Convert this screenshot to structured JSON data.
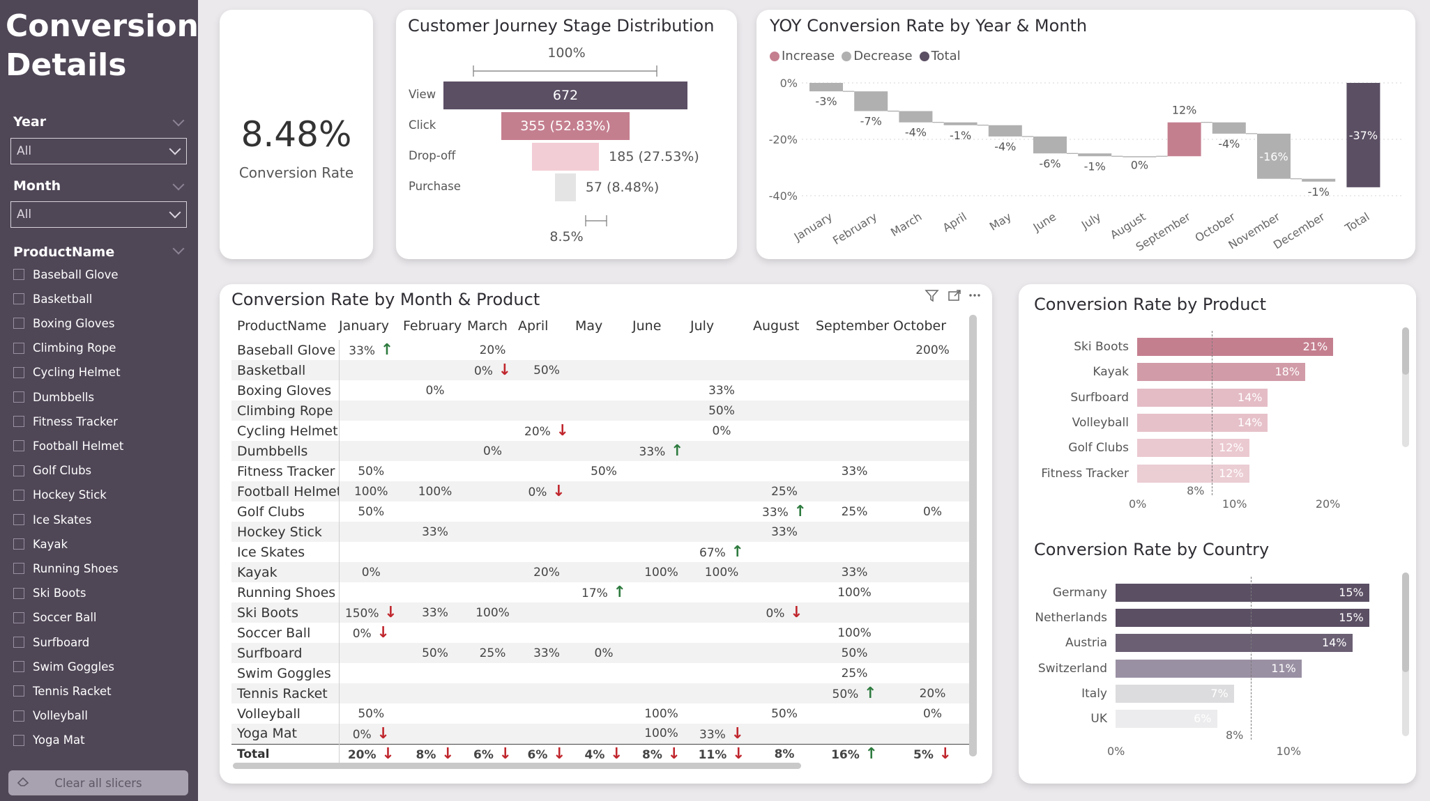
{
  "sidebar": {
    "title_line1": "Conversion",
    "title_line2": "Details",
    "year_label": "Year",
    "year_value": "All",
    "month_label": "Month",
    "month_value": "All",
    "product_label": "ProductName",
    "products": [
      "Baseball Glove",
      "Basketball",
      "Boxing Gloves",
      "Climbing Rope",
      "Cycling Helmet",
      "Dumbbells",
      "Fitness Tracker",
      "Football Helmet",
      "Golf Clubs",
      "Hockey Stick",
      "Ice Skates",
      "Kayak",
      "Running Shoes",
      "Ski Boots",
      "Soccer Ball",
      "Surfboard",
      "Swim Goggles",
      "Tennis Racket",
      "Volleyball",
      "Yoga Mat"
    ],
    "clear_label": "Clear all slicers"
  },
  "kpi": {
    "value": "8.48%",
    "label": "Conversion Rate"
  },
  "funnel": {
    "title": "Customer Journey Stage Distribution",
    "top_label": "100%",
    "bottom_label": "8.5%",
    "stages": [
      {
        "label": "View",
        "value": 672,
        "text": "672",
        "color": "#5b4f64"
      },
      {
        "label": "Click",
        "value": 355,
        "text": "355 (52.83%)",
        "color": "#c47f8f"
      },
      {
        "label": "Drop-off",
        "value": 185,
        "text": "185 (27.53%)",
        "color": "#f3cdd5"
      },
      {
        "label": "Purchase",
        "value": 57,
        "text": "57 (8.48%)",
        "color": "#e4e4e4"
      }
    ]
  },
  "waterfall": {
    "title": "YOY Conversion Rate by Year & Month",
    "legend": [
      {
        "label": "Increase",
        "color": "#c47f8f"
      },
      {
        "label": "Decrease",
        "color": "#b0b0b0"
      },
      {
        "label": "Total",
        "color": "#5b4f64"
      }
    ],
    "y_ticks": [
      "0%",
      "-20%",
      "-40%"
    ]
  },
  "chart_data": [
    {
      "type": "bar",
      "title": "YOY Conversion Rate by Year & Month",
      "subtype": "waterfall",
      "categories": [
        "January",
        "February",
        "March",
        "April",
        "May",
        "June",
        "July",
        "August",
        "September",
        "October",
        "November",
        "December",
        "Total"
      ],
      "values": [
        -3,
        -7,
        -4,
        -1,
        -4,
        -6,
        -1,
        0,
        12,
        -4,
        -16,
        -1,
        -37
      ],
      "labels": [
        "-3%",
        "-7%",
        "-4%",
        "-1%",
        "-4%",
        "-6%",
        "-1%",
        "0%",
        "12%",
        "-4%",
        "-16%",
        "-1%",
        "-37%"
      ],
      "ylim": [
        -40,
        0
      ]
    },
    {
      "type": "bar",
      "title": "Conversion Rate by Product",
      "categories": [
        "Ski Boots",
        "Kayak",
        "Surfboard",
        "Volleyball",
        "Golf Clubs",
        "Fitness Tracker"
      ],
      "values": [
        21,
        18,
        14,
        14,
        12,
        12
      ],
      "labels": [
        "21%",
        "18%",
        "14%",
        "14%",
        "12%",
        "12%"
      ],
      "reference_line": 8,
      "reference_label": "8%",
      "x_ticks": [
        "0%",
        "10%",
        "20%"
      ],
      "xlim": [
        0,
        23
      ],
      "colors": [
        "#c47f8f",
        "#d19ba8",
        "#e4bcc6",
        "#e6c1ca",
        "#ebc9d1",
        "#ebcdd4"
      ]
    },
    {
      "type": "bar",
      "title": "Conversion Rate by Country",
      "categories": [
        "Germany",
        "Netherlands",
        "Austria",
        "Switzerland",
        "Italy",
        "UK"
      ],
      "values": [
        15,
        15,
        14,
        11,
        7,
        6
      ],
      "labels": [
        "15%",
        "15%",
        "14%",
        "11%",
        "7%",
        "6%"
      ],
      "reference_line": 8,
      "reference_label": "8%",
      "x_ticks": [
        "0%",
        "10%"
      ],
      "xlim": [
        0,
        16
      ],
      "colors": [
        "#5b4f64",
        "#5b4f64",
        "#6a5f73",
        "#9a90a3",
        "#dcdcde",
        "#ececee"
      ]
    }
  ],
  "matrix": {
    "title": "Conversion Rate by Month & Product",
    "columns": [
      "ProductName",
      "January",
      "February",
      "March",
      "April",
      "May",
      "June",
      "July",
      "August",
      "September",
      "October"
    ],
    "rows": [
      {
        "name": "Baseball Glove",
        "cells": [
          [
            "33%",
            "up"
          ],
          [
            "",
            ""
          ],
          [
            "20%",
            ""
          ],
          [
            "",
            ""
          ],
          [
            "",
            ""
          ],
          [
            "",
            ""
          ],
          [
            "",
            ""
          ],
          [
            "",
            ""
          ],
          [
            "",
            ""
          ],
          [
            "200%",
            ""
          ]
        ]
      },
      {
        "name": "Basketball",
        "cells": [
          [
            "",
            ""
          ],
          [
            "",
            ""
          ],
          [
            "0%",
            "down"
          ],
          [
            "50%",
            ""
          ],
          [
            "",
            ""
          ],
          [
            "",
            ""
          ],
          [
            "",
            ""
          ],
          [
            "",
            ""
          ],
          [
            "",
            ""
          ],
          [
            "",
            ""
          ]
        ]
      },
      {
        "name": "Boxing Gloves",
        "cells": [
          [
            "",
            ""
          ],
          [
            "0%",
            ""
          ],
          [
            "",
            ""
          ],
          [
            "",
            ""
          ],
          [
            "",
            ""
          ],
          [
            "",
            ""
          ],
          [
            "33%",
            ""
          ],
          [
            "",
            ""
          ],
          [
            "",
            ""
          ],
          [
            "",
            ""
          ]
        ]
      },
      {
        "name": "Climbing Rope",
        "cells": [
          [
            "",
            ""
          ],
          [
            "",
            ""
          ],
          [
            "",
            ""
          ],
          [
            "",
            ""
          ],
          [
            "",
            ""
          ],
          [
            "",
            ""
          ],
          [
            "50%",
            ""
          ],
          [
            "",
            ""
          ],
          [
            "",
            ""
          ],
          [
            "",
            ""
          ]
        ]
      },
      {
        "name": "Cycling Helmet",
        "cells": [
          [
            "",
            ""
          ],
          [
            "",
            ""
          ],
          [
            "",
            ""
          ],
          [
            "20%",
            "down"
          ],
          [
            "",
            ""
          ],
          [
            "",
            ""
          ],
          [
            "0%",
            ""
          ],
          [
            "",
            ""
          ],
          [
            "",
            ""
          ],
          [
            "",
            ""
          ]
        ]
      },
      {
        "name": "Dumbbells",
        "cells": [
          [
            "",
            ""
          ],
          [
            "",
            ""
          ],
          [
            "0%",
            ""
          ],
          [
            "",
            ""
          ],
          [
            "",
            ""
          ],
          [
            "33%",
            "up"
          ],
          [
            "",
            ""
          ],
          [
            "",
            ""
          ],
          [
            "",
            ""
          ],
          [
            "",
            ""
          ]
        ]
      },
      {
        "name": "Fitness Tracker",
        "cells": [
          [
            "50%",
            ""
          ],
          [
            "",
            ""
          ],
          [
            "",
            ""
          ],
          [
            "",
            ""
          ],
          [
            "50%",
            ""
          ],
          [
            "",
            ""
          ],
          [
            "",
            ""
          ],
          [
            "",
            ""
          ],
          [
            "33%",
            ""
          ],
          [
            "",
            ""
          ]
        ]
      },
      {
        "name": "Football Helmet",
        "cells": [
          [
            "100%",
            ""
          ],
          [
            "100%",
            ""
          ],
          [
            "",
            ""
          ],
          [
            "0%",
            "down"
          ],
          [
            "",
            ""
          ],
          [
            "",
            ""
          ],
          [
            "",
            ""
          ],
          [
            "25%",
            ""
          ],
          [
            "",
            ""
          ],
          [
            "",
            ""
          ]
        ]
      },
      {
        "name": "Golf Clubs",
        "cells": [
          [
            "50%",
            ""
          ],
          [
            "",
            ""
          ],
          [
            "",
            ""
          ],
          [
            "",
            ""
          ],
          [
            "",
            ""
          ],
          [
            "",
            ""
          ],
          [
            "",
            ""
          ],
          [
            "33%",
            "up"
          ],
          [
            "25%",
            ""
          ],
          [
            "0%",
            ""
          ]
        ]
      },
      {
        "name": "Hockey Stick",
        "cells": [
          [
            "",
            ""
          ],
          [
            "33%",
            ""
          ],
          [
            "",
            ""
          ],
          [
            "",
            ""
          ],
          [
            "",
            ""
          ],
          [
            "",
            ""
          ],
          [
            "",
            ""
          ],
          [
            "33%",
            ""
          ],
          [
            "",
            ""
          ],
          [
            "",
            ""
          ]
        ]
      },
      {
        "name": "Ice Skates",
        "cells": [
          [
            "",
            ""
          ],
          [
            "",
            ""
          ],
          [
            "",
            ""
          ],
          [
            "",
            ""
          ],
          [
            "",
            ""
          ],
          [
            "",
            ""
          ],
          [
            "67%",
            "up"
          ],
          [
            "",
            ""
          ],
          [
            "",
            ""
          ],
          [
            "",
            ""
          ]
        ]
      },
      {
        "name": "Kayak",
        "cells": [
          [
            "0%",
            ""
          ],
          [
            "",
            ""
          ],
          [
            "",
            ""
          ],
          [
            "20%",
            ""
          ],
          [
            "",
            ""
          ],
          [
            "100%",
            ""
          ],
          [
            "100%",
            ""
          ],
          [
            "",
            ""
          ],
          [
            "33%",
            ""
          ],
          [
            "",
            ""
          ]
        ]
      },
      {
        "name": "Running Shoes",
        "cells": [
          [
            "",
            ""
          ],
          [
            "",
            ""
          ],
          [
            "",
            ""
          ],
          [
            "",
            ""
          ],
          [
            "17%",
            "up"
          ],
          [
            "",
            ""
          ],
          [
            "",
            ""
          ],
          [
            "",
            ""
          ],
          [
            "100%",
            ""
          ],
          [
            "",
            ""
          ]
        ]
      },
      {
        "name": "Ski Boots",
        "cells": [
          [
            "150%",
            "down"
          ],
          [
            "33%",
            ""
          ],
          [
            "100%",
            ""
          ],
          [
            "",
            ""
          ],
          [
            "",
            ""
          ],
          [
            "",
            ""
          ],
          [
            "",
            ""
          ],
          [
            "0%",
            "down"
          ],
          [
            "",
            ""
          ],
          [
            "",
            ""
          ]
        ]
      },
      {
        "name": "Soccer Ball",
        "cells": [
          [
            "0%",
            "down"
          ],
          [
            "",
            ""
          ],
          [
            "",
            ""
          ],
          [
            "",
            ""
          ],
          [
            "",
            ""
          ],
          [
            "",
            ""
          ],
          [
            "",
            ""
          ],
          [
            "",
            ""
          ],
          [
            "100%",
            ""
          ],
          [
            "",
            ""
          ]
        ]
      },
      {
        "name": "Surfboard",
        "cells": [
          [
            "",
            ""
          ],
          [
            "50%",
            ""
          ],
          [
            "25%",
            ""
          ],
          [
            "33%",
            ""
          ],
          [
            "0%",
            ""
          ],
          [
            "",
            ""
          ],
          [
            "",
            ""
          ],
          [
            "",
            ""
          ],
          [
            "50%",
            ""
          ],
          [
            "",
            ""
          ]
        ]
      },
      {
        "name": "Swim Goggles",
        "cells": [
          [
            "",
            ""
          ],
          [
            "",
            ""
          ],
          [
            "",
            ""
          ],
          [
            "",
            ""
          ],
          [
            "",
            ""
          ],
          [
            "",
            ""
          ],
          [
            "",
            ""
          ],
          [
            "",
            ""
          ],
          [
            "25%",
            ""
          ],
          [
            "",
            ""
          ]
        ]
      },
      {
        "name": "Tennis Racket",
        "cells": [
          [
            "",
            ""
          ],
          [
            "",
            ""
          ],
          [
            "",
            ""
          ],
          [
            "",
            ""
          ],
          [
            "",
            ""
          ],
          [
            "",
            ""
          ],
          [
            "",
            ""
          ],
          [
            "",
            ""
          ],
          [
            "50%",
            "up"
          ],
          [
            "20%",
            ""
          ]
        ]
      },
      {
        "name": "Volleyball",
        "cells": [
          [
            "50%",
            ""
          ],
          [
            "",
            ""
          ],
          [
            "",
            ""
          ],
          [
            "",
            ""
          ],
          [
            "",
            ""
          ],
          [
            "100%",
            ""
          ],
          [
            "",
            ""
          ],
          [
            "50%",
            ""
          ],
          [
            "",
            ""
          ],
          [
            "0%",
            ""
          ]
        ]
      },
      {
        "name": "Yoga Mat",
        "cells": [
          [
            "0%",
            "down"
          ],
          [
            "",
            ""
          ],
          [
            "",
            ""
          ],
          [
            "",
            ""
          ],
          [
            "",
            ""
          ],
          [
            "100%",
            ""
          ],
          [
            "33%",
            "down"
          ],
          [
            "",
            ""
          ],
          [
            "",
            ""
          ],
          [
            "",
            ""
          ]
        ]
      }
    ],
    "total": {
      "name": "Total",
      "cells": [
        [
          "20%",
          "down"
        ],
        [
          "8%",
          "down"
        ],
        [
          "6%",
          "down"
        ],
        [
          "6%",
          "down"
        ],
        [
          "4%",
          "down"
        ],
        [
          "8%",
          "down"
        ],
        [
          "11%",
          "down"
        ],
        [
          "8%",
          ""
        ],
        [
          "16%",
          "up"
        ],
        [
          "5%",
          "down"
        ]
      ]
    }
  },
  "product_chart": {
    "title": "Conversion Rate by Product"
  },
  "country_chart": {
    "title": "Conversion Rate by Country"
  }
}
